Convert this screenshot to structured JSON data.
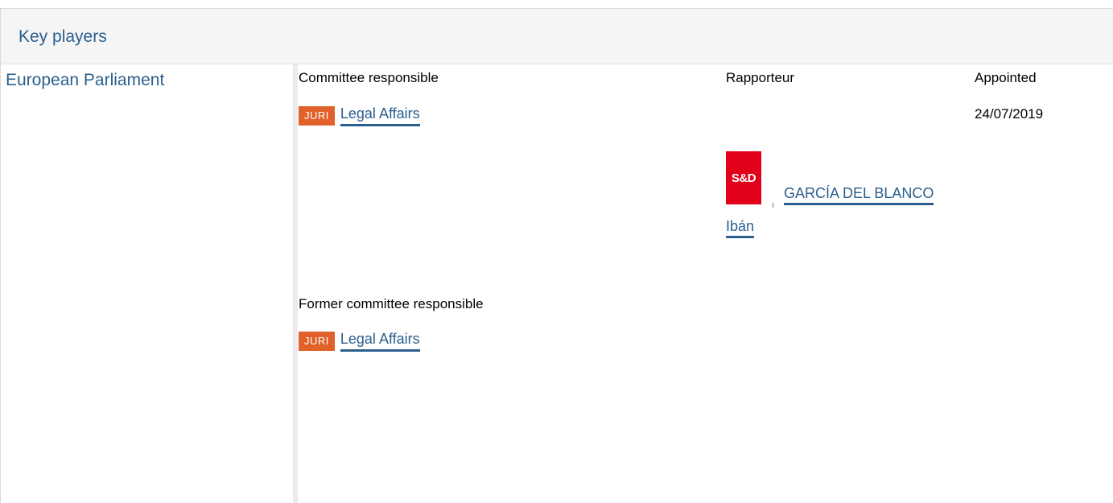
{
  "section": {
    "title": "Key players"
  },
  "institution": {
    "name": "European Parliament"
  },
  "columns": {
    "committee": "Committee responsible",
    "rapporteur": "Rapporteur",
    "appointed": "Appointed"
  },
  "committee_responsible": {
    "badge": "JURI",
    "name": "Legal Affairs",
    "appointed": "24/07/2019",
    "badge_color": "#e0622a"
  },
  "rapporteur": {
    "group_logo": "S&D",
    "group_color": "#e3001b",
    "name_line1": "GARCÍA DEL BLANCO",
    "name_line2": "Ibán"
  },
  "former_committee": {
    "heading": "Former committee responsible",
    "badge": "JURI",
    "name": "Legal Affairs"
  },
  "colors": {
    "link": "#2b5f8e",
    "header_bg": "#f5f5f5"
  }
}
